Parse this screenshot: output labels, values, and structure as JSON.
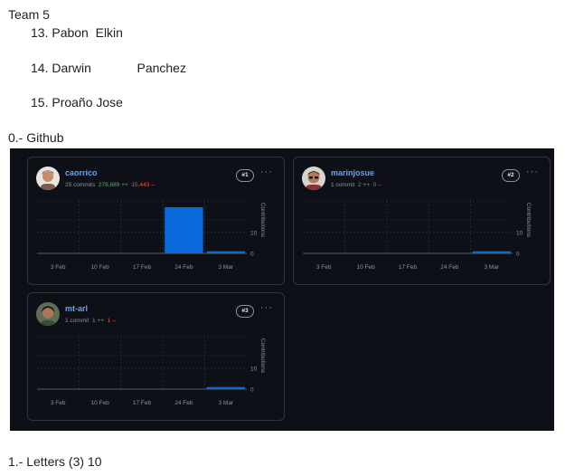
{
  "doc": {
    "team_heading": "Team 5",
    "members": [
      "13. Pabon  Elkin",
      "14. Darwin             Panchez",
      "15. Proaño Jose"
    ],
    "github_heading": "0.- Github",
    "letters_line": "1.- Letters (3) 10"
  },
  "colors": {
    "panel_bg": "#0d1117",
    "bar": "#1f6feb",
    "link": "#58a6ff",
    "additions": "#3fb950",
    "deletions": "#f85149"
  },
  "cards": [
    {
      "username": "caorrico",
      "commits": "25 commits",
      "additions": "278,689 ++",
      "deletions": "15,443 --",
      "rank": "#1",
      "avatar_icon": "user-avatar-icon"
    },
    {
      "username": "marinjosue",
      "commits": "1 commit",
      "additions": "2 ++",
      "deletions": "0 --",
      "rank": "#2",
      "avatar_icon": "user-avatar-icon"
    },
    {
      "username": "mt-arl",
      "commits": "1 commit",
      "additions": "1 ++",
      "deletions": "1 --",
      "rank": "#3",
      "avatar_icon": "user-avatar-icon"
    }
  ],
  "chart_data": [
    {
      "type": "bar",
      "title": "",
      "categories": [
        "3 Feb",
        "10 Feb",
        "17 Feb",
        "24 Feb",
        "3 Mar"
      ],
      "values": [
        0,
        0,
        0,
        22,
        1
      ],
      "ylabel": "Contributions",
      "yticks": [
        0,
        10
      ],
      "ylim": [
        0,
        25
      ],
      "grid": true
    },
    {
      "type": "bar",
      "title": "",
      "categories": [
        "3 Feb",
        "10 Feb",
        "17 Feb",
        "24 Feb",
        "3 Mar"
      ],
      "values": [
        0,
        0,
        0,
        0,
        1
      ],
      "ylabel": "Contributions",
      "yticks": [
        0,
        10
      ],
      "ylim": [
        0,
        25
      ],
      "grid": true
    },
    {
      "type": "bar",
      "title": "",
      "categories": [
        "3 Feb",
        "10 Feb",
        "17 Feb",
        "24 Feb",
        "3 Mar"
      ],
      "values": [
        0,
        0,
        0,
        0,
        1
      ],
      "ylabel": "Contributions",
      "yticks": [
        0,
        10
      ],
      "ylim": [
        0,
        25
      ],
      "grid": true
    }
  ]
}
